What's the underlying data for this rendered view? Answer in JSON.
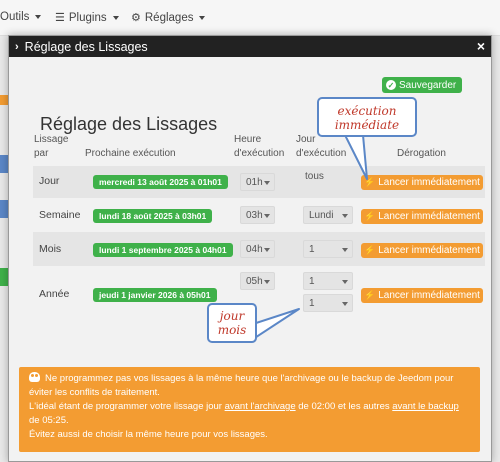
{
  "topnav": {
    "outils_label": "Outils",
    "plugins_label": "Plugins",
    "reglages_label": "Réglages"
  },
  "modal": {
    "title": "Réglage des Lissages",
    "close_label": "×"
  },
  "save_label": "Sauvegarder",
  "page_title": "Réglage des Lissages",
  "headers": {
    "lissage_l1": "Lissage",
    "lissage_l2": "par",
    "prochaine": "Prochaine exécution",
    "heure_l1": "Heure",
    "heure_l2": "d'exécution",
    "jour_l1": "Jour",
    "jour_l2": "d'exécution",
    "derogation": "Dérogation"
  },
  "rows": [
    {
      "label": "Jour",
      "next": "mercredi 13 août 2025 à 01h01",
      "hour": "01h",
      "day": "tous",
      "action": "Lancer immédiatement"
    },
    {
      "label": "Semaine",
      "next": "lundi 18 août 2025 à 03h01",
      "hour": "03h",
      "day": "Lundi",
      "action": "Lancer immédiatement"
    },
    {
      "label": "Mois",
      "next": "lundi 1 septembre 2025 à 04h01",
      "hour": "04h",
      "day": "1",
      "action": "Lancer immédiatement"
    },
    {
      "label": "Année",
      "next": "jeudi 1 janvier 2026 à 05h01",
      "hour": "05h",
      "day": "1",
      "month": "1",
      "action": "Lancer immédiatement"
    }
  ],
  "callouts": {
    "execution_l1": "exécution",
    "execution_l2": "immédiate",
    "jourmois_l1": "jour",
    "jourmois_l2": "mois"
  },
  "alert": {
    "line1": "Ne programmez pas vos lissages à la même heure que l'archivage ou le backup de Jeedom pour éviter les conflits de traitement.",
    "line2_a": "L'idéal étant de programmer votre lissage jour ",
    "line2_link1": "avant l'archivage",
    "line2_b": " de 02:00 et les autres ",
    "line2_link2": "avant le backup",
    "line2_c": " de 05:25.",
    "line3": "Évitez aussi de choisir la même heure pour vos lissages."
  },
  "colors": {
    "green": "#3fb14a",
    "orange": "#f39c32",
    "callout_border": "#5b87c7",
    "callout_text": "#c0392b"
  }
}
